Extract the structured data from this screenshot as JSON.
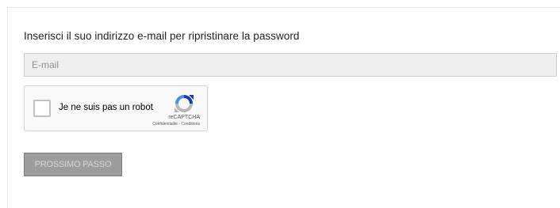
{
  "form": {
    "instruction": "Inserisci il suo indirizzo e-mail per ripristinare la password",
    "email_placeholder": "E-mail",
    "email_value": "",
    "next_button_label": "PROSSIMO PASSO"
  },
  "recaptcha": {
    "checkbox_label": "Je ne suis pas un robot",
    "brand": "reCAPTCHA",
    "privacy_link": "Confidentialité",
    "separator": " - ",
    "terms_link": "Conditions",
    "logo_icon": "recaptcha-logo-icon",
    "colors": {
      "logo_blue": "#1c3aa9",
      "logo_light_blue": "#4a90e2",
      "logo_gray": "#b7b7b7"
    }
  },
  "colors": {
    "button_background": "#9d9d9d",
    "field_background": "#efefef"
  }
}
